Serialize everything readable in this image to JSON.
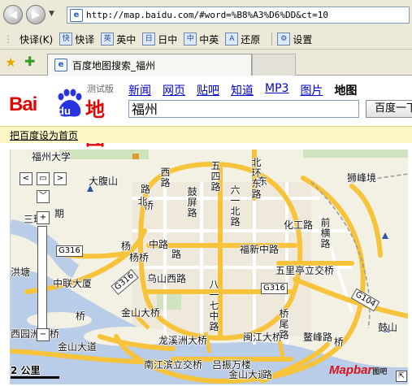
{
  "browser": {
    "url": "http://map.baidu.com/#word=%B8%A3%D6%DD&ct=10",
    "tab_title": "百度地图搜索_福州"
  },
  "toolbar": {
    "title": "快译(K)",
    "items": [
      "快译",
      "英中",
      "日中",
      "中英",
      "还原",
      "设置"
    ]
  },
  "page": {
    "logo_left": "Bai",
    "logo_mid": "du",
    "logo_right": "地图",
    "beta_label": "测试版",
    "nav_links": [
      "新闻",
      "网页",
      "贴吧",
      "知道",
      "MP3",
      "图片",
      "地图"
    ],
    "search_value": "福州",
    "search_button": "百度一下",
    "set_homepage": "把百度设为首页"
  },
  "map": {
    "labels": {
      "l1": "大腹山",
      "l2": "狮峰境",
      "l3": "化工路",
      "l4": "福新中路",
      "l5": "五里亭立交桥",
      "l6": "乌山西路",
      "l7": "中联大厦",
      "l8": "洪塘",
      "l9": "金山大桥",
      "l10": "龙溪洲大桥",
      "l11": "闽江大桥",
      "l12": "金山大道",
      "l13": "南江滨立交桥",
      "l14": "吕振万楼",
      "l15": "鳌峰路",
      "l16": "鼓山",
      "l17": "杨桥",
      "l18": "中路",
      "l19": "三环",
      "l20": "期",
      "l21": "西园洲大桥",
      "l22": "桥",
      "l23": "桥",
      "l24": "路",
      "l25": "路",
      "l26": "桥",
      "l27": "金山大道",
      "l28": "路",
      "l29": "福州大学",
      "l30": "东",
      "l31": "杨"
    },
    "vlabels": {
      "v1": "五四路",
      "v2": "六一北路",
      "v3": "鼓屏路",
      "v4": "北环东路",
      "v5": "前横路",
      "v6": "八一七中路",
      "v7": "西路",
      "v8": "北",
      "v9": "桥尾路"
    },
    "shields": [
      "G316",
      "G316",
      "G104"
    ],
    "scale": "2 公里",
    "provider": "Mapbar",
    "provider_suffix": "图吧",
    "controls": {
      "up": "︿",
      "left": "<",
      "right": ">",
      "down": "﹀",
      "center": "▭",
      "zoom_in": "+",
      "zoom_out": "−"
    }
  }
}
